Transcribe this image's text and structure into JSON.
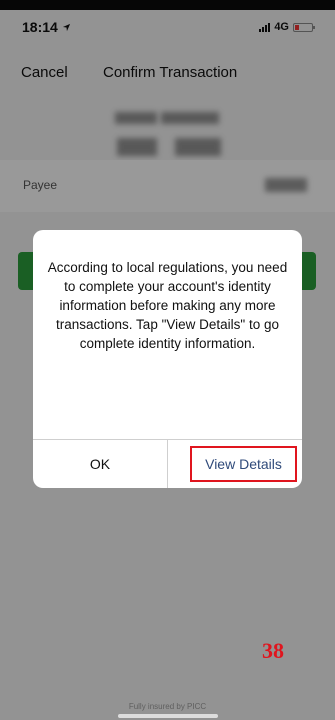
{
  "status_bar": {
    "time": "18:14",
    "network": "4G"
  },
  "nav": {
    "cancel_label": "Cancel",
    "title": "Confirm Transaction"
  },
  "form": {
    "payee_label": "Payee"
  },
  "dialog": {
    "message": "According to local regulations, you need to complete your account's identity information before making any more transactions. Tap \"View Details\" to go complete identity information.",
    "ok_label": "OK",
    "view_details_label": "View Details"
  },
  "footer": {
    "insured_text": "Fully insured by PICC"
  },
  "annotation": {
    "page_number": "38",
    "highlight_color": "#e0151e"
  },
  "icons": [
    "location-arrow-icon",
    "signal-icon",
    "battery-icon"
  ]
}
